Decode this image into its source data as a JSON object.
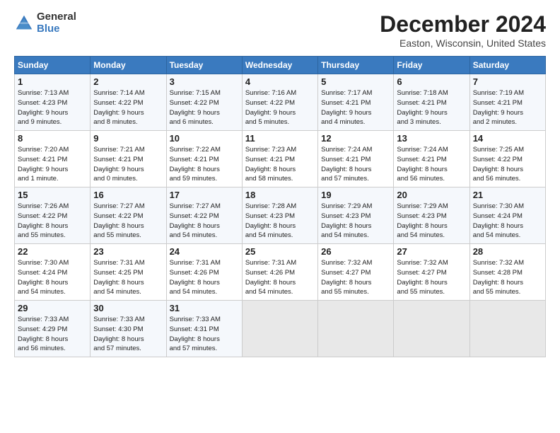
{
  "logo": {
    "general": "General",
    "blue": "Blue"
  },
  "title": "December 2024",
  "location": "Easton, Wisconsin, United States",
  "days_of_week": [
    "Sunday",
    "Monday",
    "Tuesday",
    "Wednesday",
    "Thursday",
    "Friday",
    "Saturday"
  ],
  "weeks": [
    [
      {
        "day": "1",
        "sunrise": "7:13 AM",
        "sunset": "4:23 PM",
        "daylight": "9 hours and 9 minutes."
      },
      {
        "day": "2",
        "sunrise": "7:14 AM",
        "sunset": "4:22 PM",
        "daylight": "9 hours and 8 minutes."
      },
      {
        "day": "3",
        "sunrise": "7:15 AM",
        "sunset": "4:22 PM",
        "daylight": "9 hours and 6 minutes."
      },
      {
        "day": "4",
        "sunrise": "7:16 AM",
        "sunset": "4:22 PM",
        "daylight": "9 hours and 5 minutes."
      },
      {
        "day": "5",
        "sunrise": "7:17 AM",
        "sunset": "4:21 PM",
        "daylight": "9 hours and 4 minutes."
      },
      {
        "day": "6",
        "sunrise": "7:18 AM",
        "sunset": "4:21 PM",
        "daylight": "9 hours and 3 minutes."
      },
      {
        "day": "7",
        "sunrise": "7:19 AM",
        "sunset": "4:21 PM",
        "daylight": "9 hours and 2 minutes."
      }
    ],
    [
      {
        "day": "8",
        "sunrise": "7:20 AM",
        "sunset": "4:21 PM",
        "daylight": "9 hours and 1 minute."
      },
      {
        "day": "9",
        "sunrise": "7:21 AM",
        "sunset": "4:21 PM",
        "daylight": "9 hours and 0 minutes."
      },
      {
        "day": "10",
        "sunrise": "7:22 AM",
        "sunset": "4:21 PM",
        "daylight": "8 hours and 59 minutes."
      },
      {
        "day": "11",
        "sunrise": "7:23 AM",
        "sunset": "4:21 PM",
        "daylight": "8 hours and 58 minutes."
      },
      {
        "day": "12",
        "sunrise": "7:24 AM",
        "sunset": "4:21 PM",
        "daylight": "8 hours and 57 minutes."
      },
      {
        "day": "13",
        "sunrise": "7:24 AM",
        "sunset": "4:21 PM",
        "daylight": "8 hours and 56 minutes."
      },
      {
        "day": "14",
        "sunrise": "7:25 AM",
        "sunset": "4:22 PM",
        "daylight": "8 hours and 56 minutes."
      }
    ],
    [
      {
        "day": "15",
        "sunrise": "7:26 AM",
        "sunset": "4:22 PM",
        "daylight": "8 hours and 55 minutes."
      },
      {
        "day": "16",
        "sunrise": "7:27 AM",
        "sunset": "4:22 PM",
        "daylight": "8 hours and 55 minutes."
      },
      {
        "day": "17",
        "sunrise": "7:27 AM",
        "sunset": "4:22 PM",
        "daylight": "8 hours and 54 minutes."
      },
      {
        "day": "18",
        "sunrise": "7:28 AM",
        "sunset": "4:23 PM",
        "daylight": "8 hours and 54 minutes."
      },
      {
        "day": "19",
        "sunrise": "7:29 AM",
        "sunset": "4:23 PM",
        "daylight": "8 hours and 54 minutes."
      },
      {
        "day": "20",
        "sunrise": "7:29 AM",
        "sunset": "4:23 PM",
        "daylight": "8 hours and 54 minutes."
      },
      {
        "day": "21",
        "sunrise": "7:30 AM",
        "sunset": "4:24 PM",
        "daylight": "8 hours and 54 minutes."
      }
    ],
    [
      {
        "day": "22",
        "sunrise": "7:30 AM",
        "sunset": "4:24 PM",
        "daylight": "8 hours and 54 minutes."
      },
      {
        "day": "23",
        "sunrise": "7:31 AM",
        "sunset": "4:25 PM",
        "daylight": "8 hours and 54 minutes."
      },
      {
        "day": "24",
        "sunrise": "7:31 AM",
        "sunset": "4:26 PM",
        "daylight": "8 hours and 54 minutes."
      },
      {
        "day": "25",
        "sunrise": "7:31 AM",
        "sunset": "4:26 PM",
        "daylight": "8 hours and 54 minutes."
      },
      {
        "day": "26",
        "sunrise": "7:32 AM",
        "sunset": "4:27 PM",
        "daylight": "8 hours and 55 minutes."
      },
      {
        "day": "27",
        "sunrise": "7:32 AM",
        "sunset": "4:27 PM",
        "daylight": "8 hours and 55 minutes."
      },
      {
        "day": "28",
        "sunrise": "7:32 AM",
        "sunset": "4:28 PM",
        "daylight": "8 hours and 55 minutes."
      }
    ],
    [
      {
        "day": "29",
        "sunrise": "7:33 AM",
        "sunset": "4:29 PM",
        "daylight": "8 hours and 56 minutes."
      },
      {
        "day": "30",
        "sunrise": "7:33 AM",
        "sunset": "4:30 PM",
        "daylight": "8 hours and 57 minutes."
      },
      {
        "day": "31",
        "sunrise": "7:33 AM",
        "sunset": "4:31 PM",
        "daylight": "8 hours and 57 minutes."
      },
      null,
      null,
      null,
      null
    ]
  ]
}
